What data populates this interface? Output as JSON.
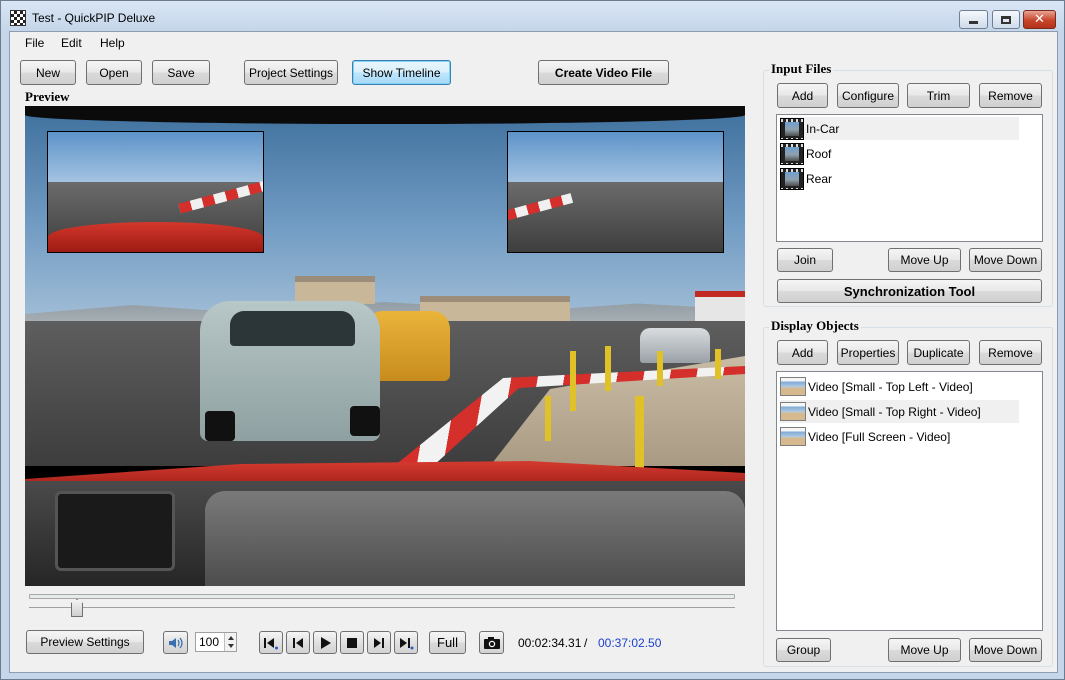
{
  "window": {
    "title": "Test - QuickPIP Deluxe",
    "controls": {
      "minimize": "minimize",
      "maximize": "maximize",
      "close": "close"
    }
  },
  "menu": [
    "File",
    "Edit",
    "Help"
  ],
  "toolbar": {
    "new": "New",
    "open": "Open",
    "save": "Save",
    "project_settings": "Project Settings",
    "show_timeline": "Show Timeline",
    "create_video": "Create Video File"
  },
  "preview": {
    "title": "Preview",
    "position_fraction": 0.07
  },
  "playback": {
    "preview_settings": "Preview Settings",
    "volume": "100",
    "full": "Full",
    "current_time": "00:02:34.31",
    "separator": "/",
    "total_time": "00:37:02.50",
    "total_time_color": "#1a3fd0"
  },
  "input_files": {
    "title": "Input Files",
    "buttons": {
      "add": "Add",
      "configure": "Configure",
      "trim": "Trim",
      "remove": "Remove"
    },
    "items": [
      {
        "label": "In-Car",
        "selected": true
      },
      {
        "label": "Roof",
        "selected": false
      },
      {
        "label": "Rear",
        "selected": false
      }
    ],
    "join": "Join",
    "move_up": "Move Up",
    "move_down": "Move Down",
    "sync_tool": "Synchronization Tool"
  },
  "display_objects": {
    "title": "Display Objects",
    "buttons": {
      "add": "Add",
      "properties": "Properties",
      "duplicate": "Duplicate",
      "remove": "Remove"
    },
    "items": [
      {
        "label": "Video [Small - Top Left - Video]",
        "selected": false
      },
      {
        "label": "Video [Small - Top Right - Video]",
        "selected": true
      },
      {
        "label": "Video [Full Screen - Video]",
        "selected": false
      }
    ],
    "group": "Group",
    "move_up": "Move Up",
    "move_down": "Move Down"
  }
}
